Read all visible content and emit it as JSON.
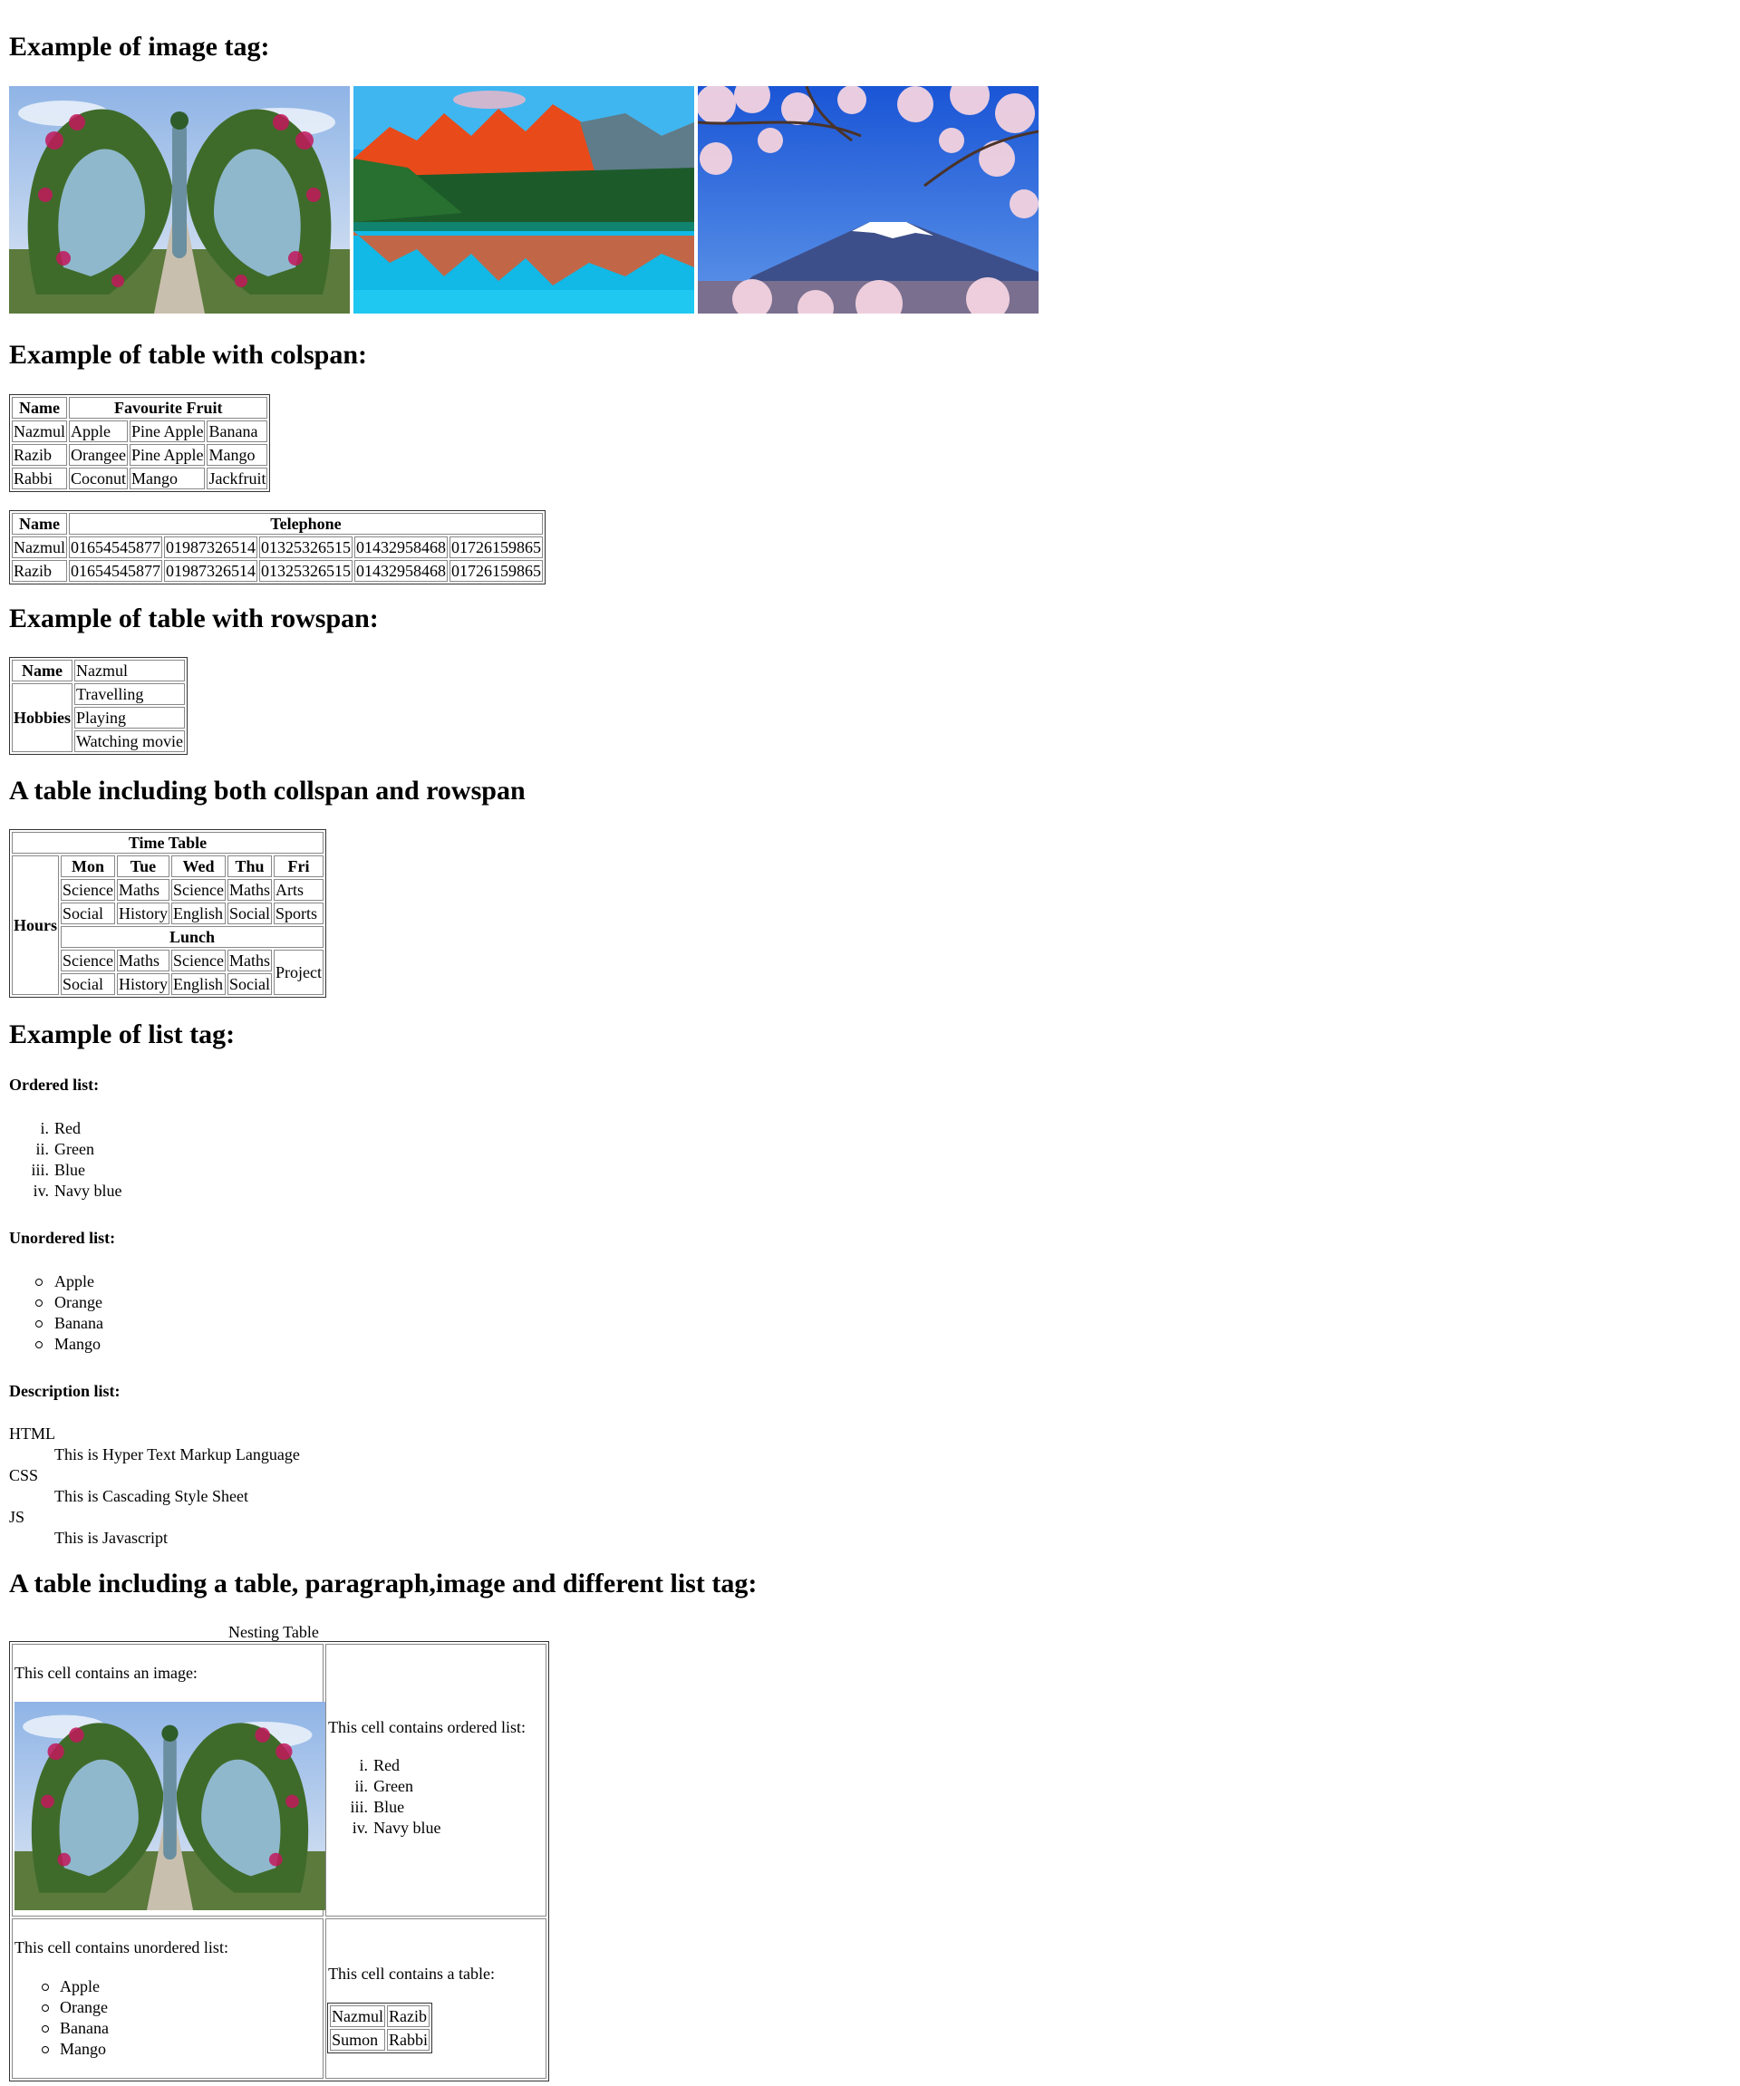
{
  "headings": {
    "image_tag": "Example of image tag:",
    "colspan": "Example of table with colspan:",
    "rowspan": "Example of table with rowspan:",
    "both": "A table including both collspan and rowspan",
    "list_tag": "Example of list tag:",
    "nesting": "A table including a table, paragraph,image and different list tag:"
  },
  "images": [
    {
      "icon": "butterfly-garden-photo"
    },
    {
      "icon": "mountain-lake-photo"
    },
    {
      "icon": "cherry-blossom-fuji-photo"
    }
  ],
  "fruit_table": {
    "headers": [
      "Name",
      "Favourite Fruit"
    ],
    "rows": [
      [
        "Nazmul",
        "Apple",
        "Pine Apple",
        "Banana"
      ],
      [
        "Razib",
        "Orangee",
        "Pine Apple",
        "Mango"
      ],
      [
        "Rabbi",
        "Coconut",
        "Mango",
        "Jackfruit"
      ]
    ]
  },
  "phone_table": {
    "headers": [
      "Name",
      "Telephone"
    ],
    "rows": [
      [
        "Nazmul",
        "01654545877",
        "01987326514",
        "01325326515",
        "01432958468",
        "01726159865"
      ],
      [
        "Razib",
        "01654545877",
        "01987326514",
        "01325326515",
        "01432958468",
        "01726159865"
      ]
    ]
  },
  "rowspan_table": {
    "name_label": "Name",
    "name_value": "Nazmul",
    "hobbies_label": "Hobbies",
    "hobbies": [
      "Travelling",
      "Playing",
      "Watching movie"
    ]
  },
  "time_table": {
    "title": "Time Table",
    "hours_label": "Hours",
    "days": [
      "Mon",
      "Tue",
      "Wed",
      "Thu",
      "Fri"
    ],
    "rows_before_lunch": [
      [
        "Science",
        "Maths",
        "Science",
        "Maths",
        "Arts"
      ],
      [
        "Social",
        "History",
        "English",
        "Social",
        "Sports"
      ]
    ],
    "lunch": "Lunch",
    "rows_after_lunch": [
      [
        "Science",
        "Maths",
        "Science",
        "Maths"
      ],
      [
        "Social",
        "History",
        "English",
        "Social"
      ]
    ],
    "project": "Project"
  },
  "lists": {
    "ordered_title": "Ordered list:",
    "ordered_markers": [
      "i.",
      "ii.",
      "iii.",
      "iv."
    ],
    "ordered_items": [
      "Red",
      "Green",
      "Blue",
      "Navy blue"
    ],
    "unordered_title": "Unordered list:",
    "unordered_items": [
      "Apple",
      "Orange",
      "Banana",
      "Mango"
    ],
    "description_title": "Description list:",
    "description": [
      {
        "term": "HTML",
        "desc": "This is Hyper Text Markup Language"
      },
      {
        "term": "CSS",
        "desc": "This is Cascading Style Sheet"
      },
      {
        "term": "JS",
        "desc": "This is Javascript"
      }
    ]
  },
  "nesting_table": {
    "caption": "Nesting Table",
    "image_cell_text": "This cell contains an image:",
    "ordered_cell_text": "This cell contains ordered list:",
    "ordered_markers": [
      "i.",
      "ii.",
      "iii.",
      "iv."
    ],
    "ordered_items": [
      "Red",
      "Green",
      "Blue",
      "Navy blue"
    ],
    "unordered_cell_text": "This cell contains unordered list:",
    "unordered_items": [
      "Apple",
      "Orange",
      "Banana",
      "Mango"
    ],
    "table_cell_text": "This cell contains a table:",
    "inner_table": [
      [
        "Nazmul",
        "Razib"
      ],
      [
        "Sumon",
        "Rabbi"
      ]
    ]
  }
}
